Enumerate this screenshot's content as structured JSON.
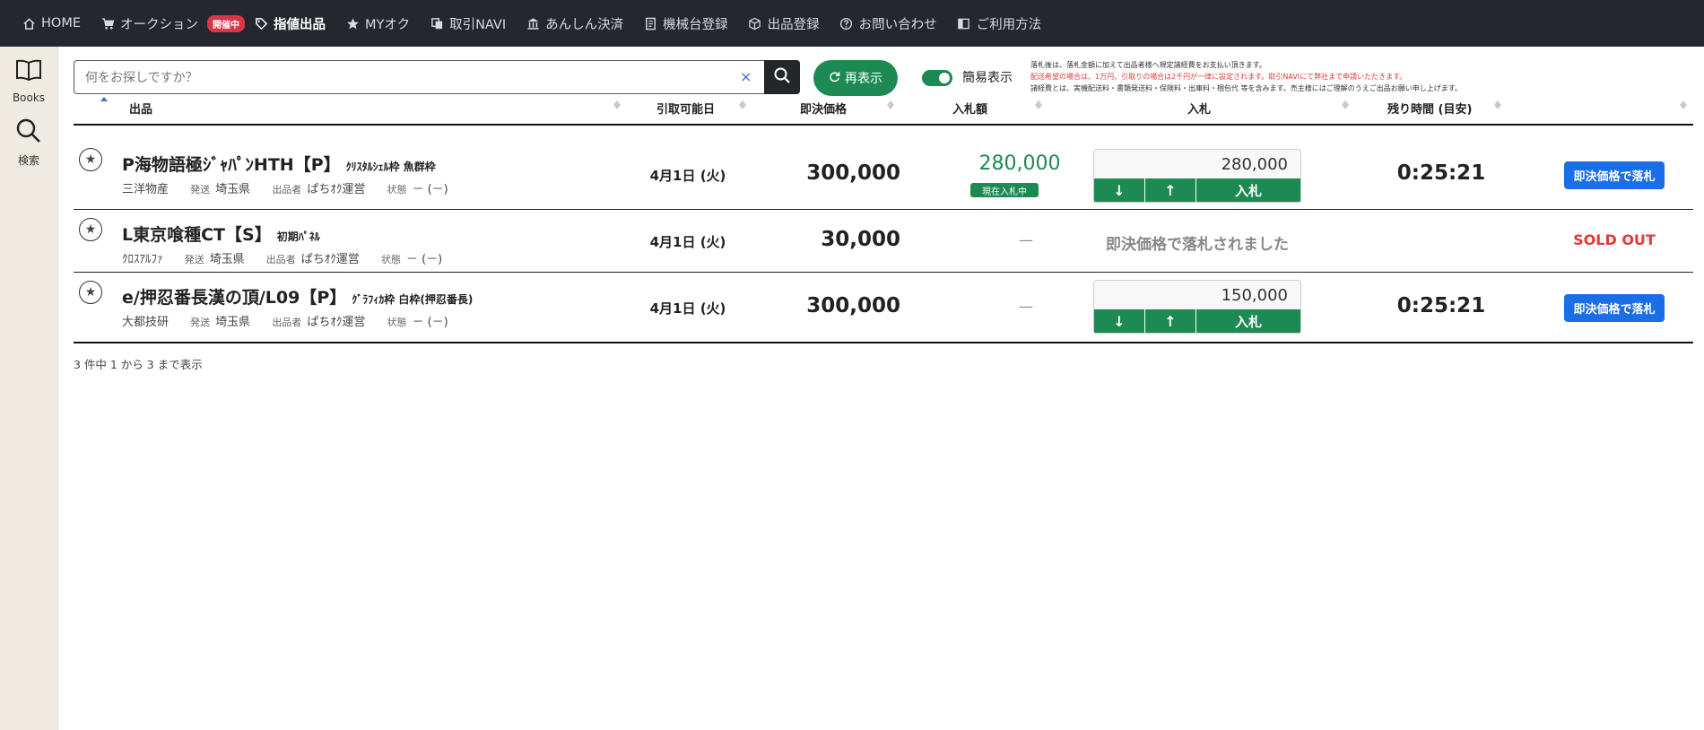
{
  "nav": {
    "items": [
      {
        "label": "HOME",
        "icon": "home-icon"
      },
      {
        "label": "オークション",
        "icon": "cart-icon"
      },
      {
        "label": "指値出品",
        "icon": "tag-icon"
      },
      {
        "label": "MYオク",
        "icon": "star-icon"
      },
      {
        "label": "取引NAVI",
        "icon": "copy-icon"
      },
      {
        "label": "あんしん決済",
        "icon": "bank-icon"
      },
      {
        "label": "機械台登録",
        "icon": "document-icon"
      },
      {
        "label": "出品登録",
        "icon": "box-icon"
      },
      {
        "label": "お問い合わせ",
        "icon": "question-icon"
      },
      {
        "label": "ご利用方法",
        "icon": "book-icon"
      }
    ],
    "live_badge": "開催中"
  },
  "sidebar": {
    "books_label": "Books",
    "search_label": "検索"
  },
  "search": {
    "placeholder": "何をお探しですか？",
    "clear": "×"
  },
  "toolbar": {
    "refresh_label": "再表示",
    "simple_view_label": "簡易表示",
    "simple_view_on": true
  },
  "notes": {
    "line1": "落札後は、落札金額に加えて出品者様へ規定諸経費をお支払い頂きます。",
    "line2": "配送希望の場合は、1万円、引取りの場合は2千円が一律に設定されます。取引NAVIにて弊社まで申請いただきます。",
    "line3": "諸経費とは、実機配送料・書類発送料・保険料・出庫料・梱包代 等を含みます。売主様にはご理解のうえご出品お願い申し上げます。"
  },
  "table": {
    "headers": {
      "item": "出品",
      "date": "引取可能日",
      "buyout": "即決価格",
      "bid_amount": "入札額",
      "bid": "入札",
      "remaining": "残り時間 (目安)"
    },
    "rows": [
      {
        "title": "P海物語極ｼﾞｬﾊﾟﾝHTH【P】",
        "sub": "ｸﾘｽﾀﾙｼｪﾙ枠 魚群枠",
        "maker": "三洋物産",
        "ship_k": "発送",
        "ship": "埼玉県",
        "seller_k": "出品者",
        "seller": "ぱちｵｸ運営",
        "cond_k": "状態",
        "cond": "－ (－)",
        "date": "4月1日 (火)",
        "buyout": "300,000",
        "bid_amount": "280,000",
        "current_badge": "現在入札中",
        "bid_input": "280,000",
        "time": "0:25:21",
        "buyout_btn": "即決価格で落札"
      },
      {
        "title": "L東京喰種CT【S】",
        "sub": "初期ﾊﾟﾈﾙ",
        "maker": "ｸﾛｽｱﾙﾌｧ",
        "ship_k": "発送",
        "ship": "埼玉県",
        "seller_k": "出品者",
        "seller": "ぱちｵｸ運営",
        "cond_k": "状態",
        "cond": "－ (－)",
        "date": "4月1日 (火)",
        "buyout": "30,000",
        "bid_amount": "—",
        "sold_msg": "即決価格で落札されました",
        "sold_out": "SOLD OUT"
      },
      {
        "title": "e/押忍番長漢の頂/L09【P】",
        "sub": "ｸﾞﾗﾌｨｶ枠 白枠(押忍番長)",
        "maker": "大都技研",
        "ship_k": "発送",
        "ship": "埼玉県",
        "seller_k": "出品者",
        "seller": "ぱちｵｸ運営",
        "cond_k": "状態",
        "cond": "－ (－)",
        "date": "4月1日 (火)",
        "buyout": "300,000",
        "bid_amount": "—",
        "bid_input": "150,000",
        "time": "0:25:21",
        "buyout_btn": "即決価格で落札"
      }
    ],
    "bid_buttons": {
      "down": "↓",
      "up": "↑",
      "bid": "入札"
    },
    "fav_icon": "★"
  },
  "footer": {
    "info": "3 件中 1 から 3 まで表示"
  },
  "colors": {
    "accent_green": "#1c8a52",
    "nav_bg": "#24272d",
    "buyout_blue": "#1a6ee6",
    "sold_red": "#e03b3b"
  }
}
